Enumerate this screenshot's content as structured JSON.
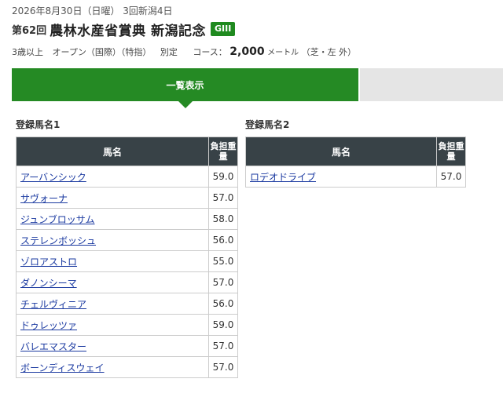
{
  "race": {
    "date_line": "2026年8月30日（日曜） 3回新潟4日",
    "race_number": "第62回",
    "name": "農林水産省賞典 新潟記念",
    "grade": "GIII",
    "conditions": {
      "age_class": "3歳以上",
      "open": "オープン（国際）（特指）",
      "weight_rule": "別定",
      "course_label": "コース：",
      "distance": "2,000",
      "unit": "メートル",
      "surface": "（芝・左 外）"
    }
  },
  "tabs": [
    {
      "label": "一覧表示",
      "active": true
    },
    {
      "label": "",
      "active": false
    }
  ],
  "groups": [
    {
      "label": "登録馬名1",
      "header": {
        "name": "馬名",
        "weight": "負担重量"
      },
      "rows": [
        {
          "name": "アーバンシック",
          "weight": "59.0"
        },
        {
          "name": "サヴォーナ",
          "weight": "57.0"
        },
        {
          "name": "ジュンブロッサム",
          "weight": "58.0"
        },
        {
          "name": "ステレンボッシュ",
          "weight": "56.0"
        },
        {
          "name": "ゾロアストロ",
          "weight": "55.0"
        },
        {
          "name": "ダノンシーマ",
          "weight": "57.0"
        },
        {
          "name": "チェルヴィニア",
          "weight": "56.0"
        },
        {
          "name": "ドゥレッツァ",
          "weight": "59.0"
        },
        {
          "name": "バレエマスター",
          "weight": "57.0"
        },
        {
          "name": "ボーンディスウェイ",
          "weight": "57.0"
        }
      ]
    },
    {
      "label": "登録馬名2",
      "header": {
        "name": "馬名",
        "weight": "負担重量"
      },
      "rows": [
        {
          "name": "ロデオドライブ",
          "weight": "57.0"
        }
      ]
    }
  ]
}
